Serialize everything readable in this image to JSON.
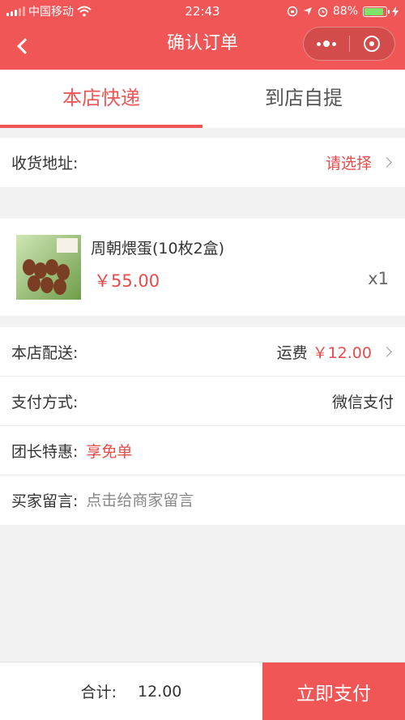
{
  "status_bar": {
    "carrier": "中国移动",
    "time": "22:43",
    "battery_percent": "88%",
    "battery_level": 0.88,
    "battery_color": "#7fe36a"
  },
  "header": {
    "title": "确认订单",
    "accent_color": "#f15656"
  },
  "tabs": [
    {
      "label": "本店快递",
      "active": true
    },
    {
      "label": "到店自提",
      "active": false
    }
  ],
  "address": {
    "label": "收货地址:",
    "value": "请选择"
  },
  "product": {
    "name": "周朝煨蛋(10枚2盒)",
    "price": "￥55.00",
    "quantity": "x1"
  },
  "details": {
    "delivery_label": "本店配送:",
    "shipping_prefix": "运费",
    "shipping_fee": "￥12.00",
    "payment_label": "支付方式:",
    "payment_value": "微信支付",
    "leader_label": "团长特惠:",
    "leader_value": "享免单",
    "message_label": "买家留言:",
    "message_placeholder": "点击给商家留言"
  },
  "footer": {
    "total_label": "合计:",
    "total_value": "12.00",
    "pay_button": "立即支付"
  }
}
